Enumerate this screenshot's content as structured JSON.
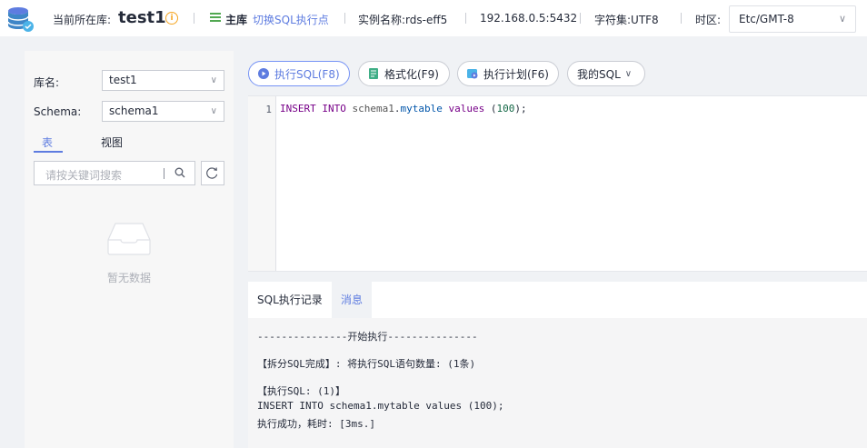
{
  "header": {
    "current_db_label": "当前所在库:",
    "current_db": "test1",
    "main_label": "主库",
    "switch_link": "切换SQL执行点",
    "instance": "实例名称:rds-eff5",
    "address": "192.168.0.5:5432",
    "charset": "字符集:UTF8",
    "timezone_label": "时区:",
    "timezone_value": "Etc/GMT-8"
  },
  "sidebar": {
    "db_label": "库名:",
    "db_value": "test1",
    "schema_label": "Schema:",
    "schema_value": "schema1",
    "tabs": [
      {
        "label": "表",
        "active": true
      },
      {
        "label": "视图",
        "active": false
      }
    ],
    "search_placeholder": "请按关键词搜索",
    "empty_text": "暂无数据"
  },
  "toolbar": {
    "execute_label": "执行SQL(F8)",
    "format_label": "格式化(F9)",
    "plan_label": "执行计划(F6)",
    "my_sql_label": "我的SQL"
  },
  "editor": {
    "line_number": "1",
    "tokens": {
      "insert": "INSERT",
      "into": "INTO",
      "schema": "schema1",
      "dot": ".",
      "table": "mytable",
      "values": "values",
      "open": "(",
      "number": "100",
      "close": ");"
    }
  },
  "results": {
    "tabs": [
      {
        "label": "SQL执行记录",
        "active": false
      },
      {
        "label": "消息",
        "active": true
      }
    ],
    "messages": [
      "---------------开始执行---------------",
      "【拆分SQL完成】: 将执行SQL语句数量: (1条)",
      "【执行SQL: (1)】",
      "INSERT INTO schema1.mytable values (100);",
      "执行成功，耗时: [3ms.]"
    ]
  },
  "colors": {
    "accent": "#5e7ce0",
    "main_db_icon": "#52a852",
    "warning": "#f5a623"
  }
}
